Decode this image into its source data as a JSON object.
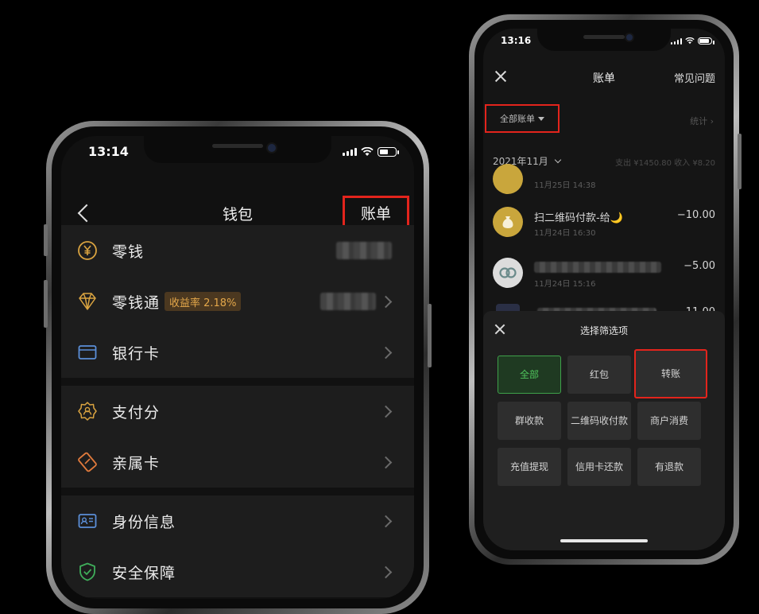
{
  "left_phone": {
    "status": {
      "time": "13:14"
    },
    "nav": {
      "title": "钱包",
      "bill": "账单"
    },
    "groups": [
      {
        "rows": [
          {
            "label": "零钱",
            "icon": "yuan-coin-icon",
            "has_value": true,
            "chevron": false
          },
          {
            "label": "零钱通",
            "icon": "diamond-icon",
            "badge": "收益率 2.18%",
            "has_value": true,
            "chevron": true
          },
          {
            "label": "银行卡",
            "icon": "bank-card-icon",
            "chevron": true
          }
        ]
      },
      {
        "rows": [
          {
            "label": "支付分",
            "icon": "pay-score-icon",
            "chevron": true
          },
          {
            "label": "亲属卡",
            "icon": "family-card-icon",
            "chevron": true
          }
        ]
      },
      {
        "rows": [
          {
            "label": "身份信息",
            "icon": "id-card-icon",
            "chevron": true
          },
          {
            "label": "安全保障",
            "icon": "shield-icon",
            "chevron": true
          }
        ]
      }
    ]
  },
  "right_phone": {
    "status": {
      "time": "13:16"
    },
    "nav": {
      "title": "账单",
      "faq": "常见问题"
    },
    "filter_all": "全部账单",
    "stats_link": "统计 ›",
    "month": "2021年11月",
    "month_summary": "支出 ¥1450.80  收入 ¥8.20",
    "transactions": [
      {
        "title": "",
        "time": "11月25日 14:38",
        "amount": ""
      },
      {
        "title": "扫二维码付款-给🌙",
        "time": "11月24日 16:30",
        "amount": "−10.00"
      },
      {
        "title": "",
        "time": "11月24日 15:16",
        "amount": "−5.00"
      },
      {
        "title": "",
        "time": "",
        "amount": "−11.00"
      }
    ],
    "sheet": {
      "title": "选择筛选项",
      "options": [
        "全部",
        "红包",
        "转账",
        "群收款",
        "二维码收付款",
        "商户消费",
        "充值提现",
        "信用卡还款",
        "有退款"
      ],
      "selected_index": 0,
      "highlight_index": 2
    }
  },
  "colors": {
    "accent_red": "#e3241c",
    "accent_green": "#3fa14a",
    "badge_text": "#e3a74a"
  }
}
